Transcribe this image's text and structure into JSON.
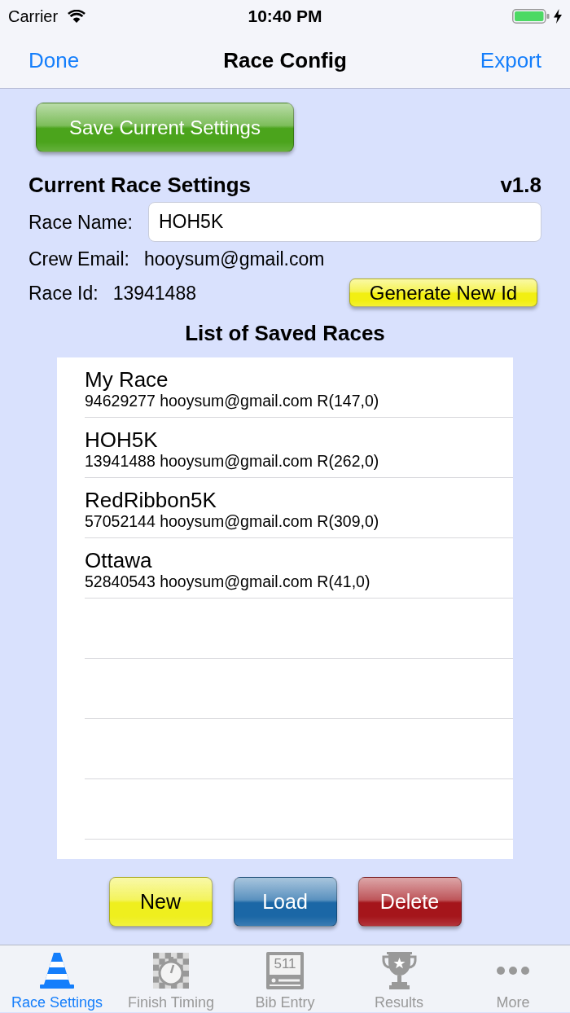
{
  "status_bar": {
    "carrier": "Carrier",
    "time": "10:40 PM"
  },
  "nav_bar": {
    "left_button": "Done",
    "title": "Race Config",
    "right_button": "Export"
  },
  "save_button": "Save Current Settings",
  "current_settings": {
    "heading": "Current Race Settings",
    "version": "v1.8",
    "race_name": {
      "label": "Race Name:",
      "value": "HOH5K"
    },
    "crew_email": {
      "label": "Crew Email:",
      "value": "hooysum@gmail.com"
    },
    "race_id": {
      "label": "Race Id:",
      "value": "13941488"
    },
    "generate_button": "Generate New Id"
  },
  "saved_races": {
    "heading": "List of Saved Races",
    "items": [
      {
        "name": "My Race",
        "detail": "94629277 hooysum@gmail.com R(147,0)",
        "selected": false
      },
      {
        "name": "HOH5K",
        "detail": "13941488 hooysum@gmail.com R(262,0)",
        "selected": false
      },
      {
        "name": "RedRibbon5K",
        "detail": "57052144 hooysum@gmail.com R(309,0)",
        "selected": false
      },
      {
        "name": "Ottawa",
        "detail": "52840543 hooysum@gmail.com R(41,0)",
        "selected": false
      }
    ]
  },
  "action_buttons": [
    {
      "label": "New",
      "color": "#efef1e"
    },
    {
      "label": "Load",
      "color": "#1b67a6"
    },
    {
      "label": "Delete",
      "color": "#a5151b"
    }
  ],
  "tab_bar": {
    "tabs": [
      {
        "label": "Race Settings",
        "selected": true
      },
      {
        "label": "Finish Timing",
        "selected": false
      },
      {
        "label": "Bib Entry",
        "selected": false,
        "icon_text": "511"
      },
      {
        "label": "Results",
        "selected": false
      },
      {
        "label": "More",
        "selected": false
      }
    ]
  }
}
